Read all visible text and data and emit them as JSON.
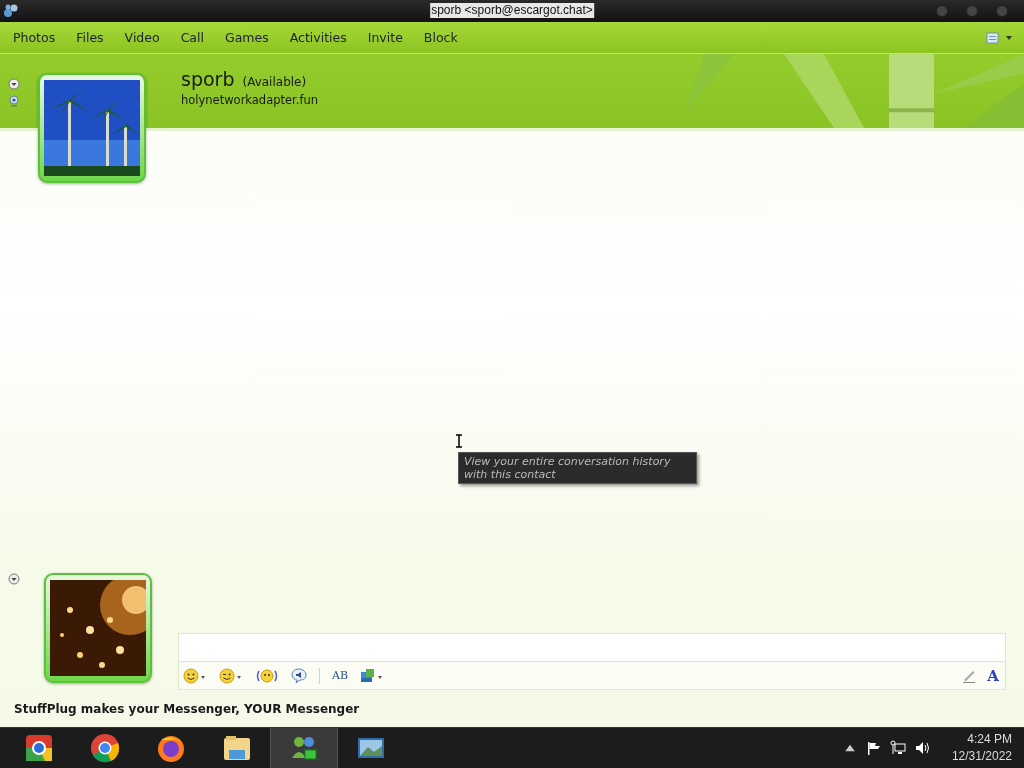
{
  "window": {
    "title": "sporb <sporb@escargot.chat>"
  },
  "menu": [
    {
      "label": "Photos"
    },
    {
      "label": "Files"
    },
    {
      "label": "Video"
    },
    {
      "label": "Call"
    },
    {
      "label": "Games"
    },
    {
      "label": "Activities"
    },
    {
      "label": "Invite"
    },
    {
      "label": "Block"
    }
  ],
  "contact": {
    "name": "sporb",
    "status": "(Available)",
    "message": "holynetworkadapter.fun"
  },
  "tooltip": {
    "lines": [
      "View your entire conversation history",
      "with this contact"
    ]
  },
  "toolbar": [
    {
      "kind": "emoticon"
    },
    {
      "kind": "wink"
    },
    {
      "kind": "nudge"
    },
    {
      "kind": "voice"
    },
    {
      "kind": "separator"
    },
    {
      "kind": "spell",
      "label": "AB"
    },
    {
      "kind": "background"
    }
  ],
  "format_button": {
    "label": "A"
  },
  "status_bar": {
    "text": "StuffPlug makes your Messenger, YOUR Messenger"
  },
  "taskbar": {
    "apps": [
      {
        "kind": "chromium",
        "selected": false
      },
      {
        "kind": "chrome",
        "selected": false
      },
      {
        "kind": "firefox",
        "selected": false
      },
      {
        "kind": "explorer",
        "selected": false
      },
      {
        "kind": "messenger",
        "selected": true
      },
      {
        "kind": "photos",
        "selected": false
      }
    ],
    "clock": {
      "time": "4:24 PM",
      "date": "12/31/2022"
    }
  }
}
